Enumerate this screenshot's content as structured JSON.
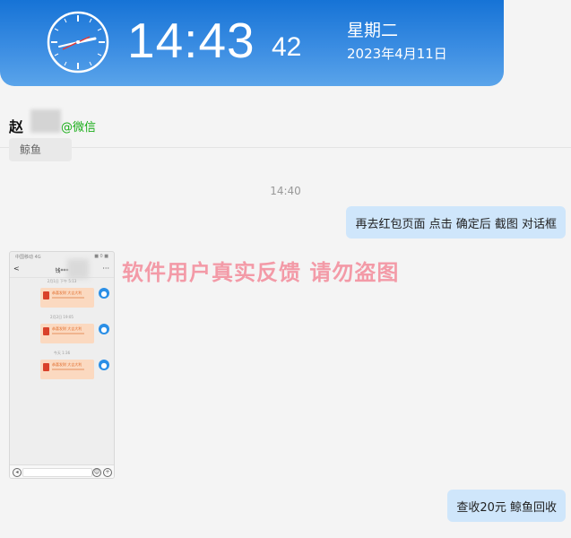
{
  "clock": {
    "time": "14:43",
    "seconds": "42",
    "weekday": "星期二",
    "date": "2023年4月11日"
  },
  "contact": {
    "name": "赵",
    "tag": "@微信",
    "prev_message": "鲸鱼"
  },
  "chat": {
    "timestamp": "14:40",
    "message_1": "再去红包页面 点击  确定后  截图 对话框",
    "watermark": "软件用户真实反馈  请勿盗图",
    "message_2": "查收20元 鲸鱼回收"
  },
  "screenshot": {
    "status_left": "中国移动 4G",
    "status_right": "■ 0 ■",
    "header_back": "<",
    "header_title": "钱***",
    "header_more": "···",
    "times": [
      "2月1日 下午 5:13",
      "2月2日 19:05",
      "今天 1:36"
    ],
    "packet_text": "恭喜发财 大吉大利",
    "avatar_icon": "person-icon"
  }
}
